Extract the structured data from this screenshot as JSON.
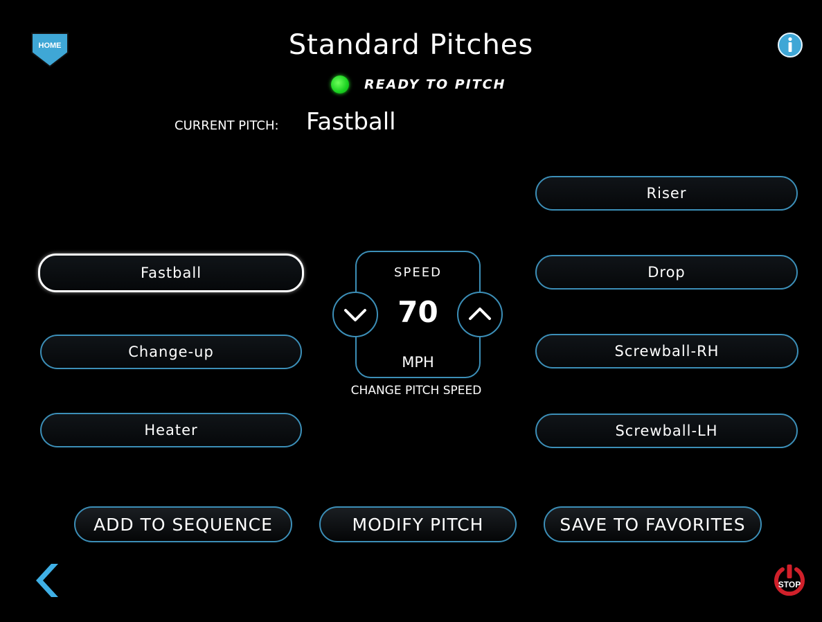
{
  "header": {
    "home_label": "HOME",
    "title": "Standard Pitches",
    "status_text": "READY TO PITCH",
    "status_color": "#19d120",
    "info_icon": "info-icon"
  },
  "current_pitch": {
    "label": "CURRENT PITCH:",
    "value": "Fastball"
  },
  "pitches_left": [
    {
      "label": "Fastball",
      "selected": true
    },
    {
      "label": "Change-up",
      "selected": false
    },
    {
      "label": "Heater",
      "selected": false
    }
  ],
  "pitches_right": [
    {
      "label": "Riser",
      "selected": false
    },
    {
      "label": "Drop",
      "selected": false
    },
    {
      "label": "Screwball-RH",
      "selected": false
    },
    {
      "label": "Screwball-LH",
      "selected": false
    }
  ],
  "speed": {
    "label": "SPEED",
    "value": "70",
    "unit": "MPH",
    "caption": "CHANGE PITCH SPEED",
    "decrease_icon": "chevron-down-icon",
    "increase_icon": "chevron-up-icon"
  },
  "actions": {
    "add_to_sequence": "ADD TO SEQUENCE",
    "modify_pitch": "MODIFY PITCH",
    "save_to_favorites": "SAVE TO FAVORITES"
  },
  "footer": {
    "back_icon": "chevron-left-icon",
    "stop_label": "STOP"
  },
  "colors": {
    "accent": "#3c8fb8",
    "home_badge": "#3fa7d6",
    "info": "#3fa7d6",
    "stop": "#d0202a",
    "back_arrow": "#3fb0e6"
  }
}
